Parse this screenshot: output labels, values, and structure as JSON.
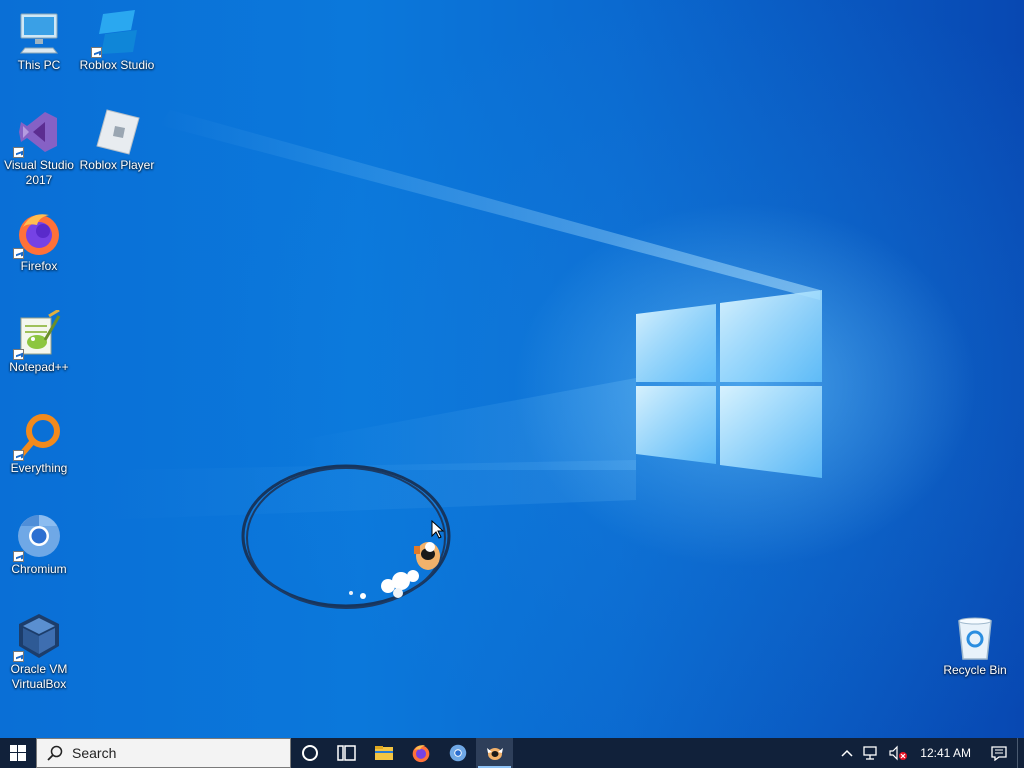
{
  "desktop": {
    "icons": [
      {
        "label": "This PC",
        "icon": "computer-icon"
      },
      {
        "label": "Roblox Studio",
        "icon": "roblox-studio-icon"
      },
      {
        "label": "Visual Studio\n2017",
        "icon": "visual-studio-icon"
      },
      {
        "label": "Roblox Player",
        "icon": "roblox-player-icon"
      },
      {
        "label": "Firefox",
        "icon": "firefox-icon"
      },
      {
        "label": "Notepad++",
        "icon": "notepad-plus-plus-icon"
      },
      {
        "label": "Everything",
        "icon": "everything-search-icon"
      },
      {
        "label": "Chromium",
        "icon": "chromium-icon"
      },
      {
        "label": "Oracle VM\nVirtualBox",
        "icon": "virtualbox-icon"
      },
      {
        "label": "Recycle Bin",
        "icon": "recycle-bin-icon"
      }
    ]
  },
  "taskbar": {
    "search_placeholder": "Search",
    "pinned": [
      "cortana-icon",
      "task-view-icon",
      "file-explorer-icon",
      "firefox-icon",
      "chromium-icon",
      "running-app-icon"
    ],
    "clock": "12:41 AM"
  },
  "colors": {
    "desktop_blue": "#0b6fd6",
    "taskbar": "#11213a",
    "accent": "#8fc3f5"
  }
}
